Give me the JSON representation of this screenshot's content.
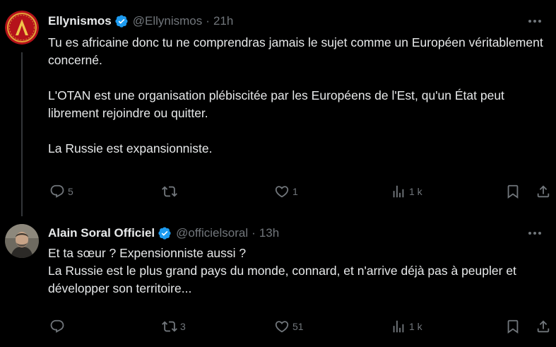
{
  "colors": {
    "background": "#000000",
    "text": "#e7e9ea",
    "secondary": "#71767b",
    "verified": "#1d9bf0",
    "thread_line": "#333639"
  },
  "tweets": [
    {
      "display_name": "Ellynismos",
      "handle": "@Ellynismos",
      "dot": "·",
      "time": "21h",
      "verified": true,
      "avatar_icon": "red-circle-lambda-icon",
      "paragraphs": [
        "Tu es africaine donc tu ne comprendras jamais le sujet comme un Européen véritablement concerné.",
        "L'OTAN est une organisation plébiscitée par les Européens de l'Est, qu'un État peut librement rejoindre ou quitter.",
        "La Russie est expansionniste."
      ],
      "actions": {
        "replies": "5",
        "retweets": "",
        "likes": "1",
        "views": "1 k"
      }
    },
    {
      "display_name": "Alain Soral Officiel",
      "handle": "@officielsoral",
      "dot": "·",
      "time": "13h",
      "verified": true,
      "avatar_icon": "profile-photo-avatar",
      "paragraphs": [
        "Et ta sœur ? Expensionniste aussi ?\nLa Russie est le plus grand pays du monde, connard, et n'arrive déjà pas à peupler et développer son territoire..."
      ],
      "actions": {
        "replies": "",
        "retweets": "3",
        "likes": "51",
        "views": "1 k"
      }
    }
  ]
}
